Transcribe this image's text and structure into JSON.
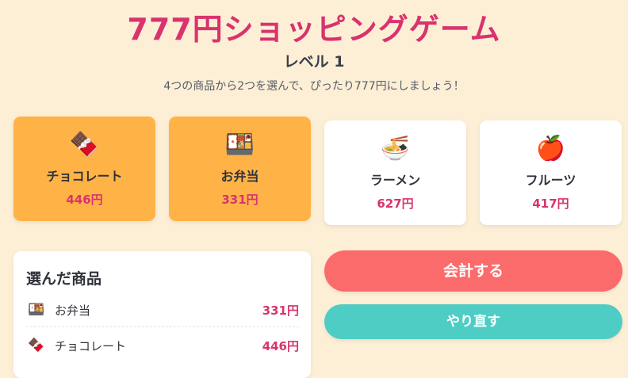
{
  "header": {
    "title": "777円ショッピングゲーム",
    "level": "レベル 1",
    "instruction": "4つの商品から2つを選んで、ぴったり777円にしましょう！"
  },
  "products": [
    {
      "icon": "chocolate-icon",
      "emoji": "🍫",
      "name": "チョコレート",
      "price": "446円",
      "selected": true
    },
    {
      "icon": "bento-icon",
      "emoji": "🍱",
      "name": "お弁当",
      "price": "331円",
      "selected": true
    },
    {
      "icon": "ramen-icon",
      "emoji": "🍜",
      "name": "ラーメン",
      "price": "627円",
      "selected": false
    },
    {
      "icon": "apple-icon",
      "emoji": "🍎",
      "name": "フルーツ",
      "price": "417円",
      "selected": false
    }
  ],
  "selected_panel": {
    "title": "選んだ商品",
    "items": [
      {
        "icon": "bento-icon",
        "emoji": "🍱",
        "name": "お弁当",
        "price": "331円"
      },
      {
        "icon": "chocolate-icon",
        "emoji": "🍫",
        "name": "チョコレート",
        "price": "446円"
      }
    ]
  },
  "actions": {
    "checkout_label": "会計する",
    "reset_label": "やり直す"
  },
  "colors": {
    "background": "#fdefd6",
    "accent": "#d9336e",
    "selected_card": "#ffb347",
    "checkout": "#fc6b6b",
    "reset": "#4ecdc4"
  }
}
